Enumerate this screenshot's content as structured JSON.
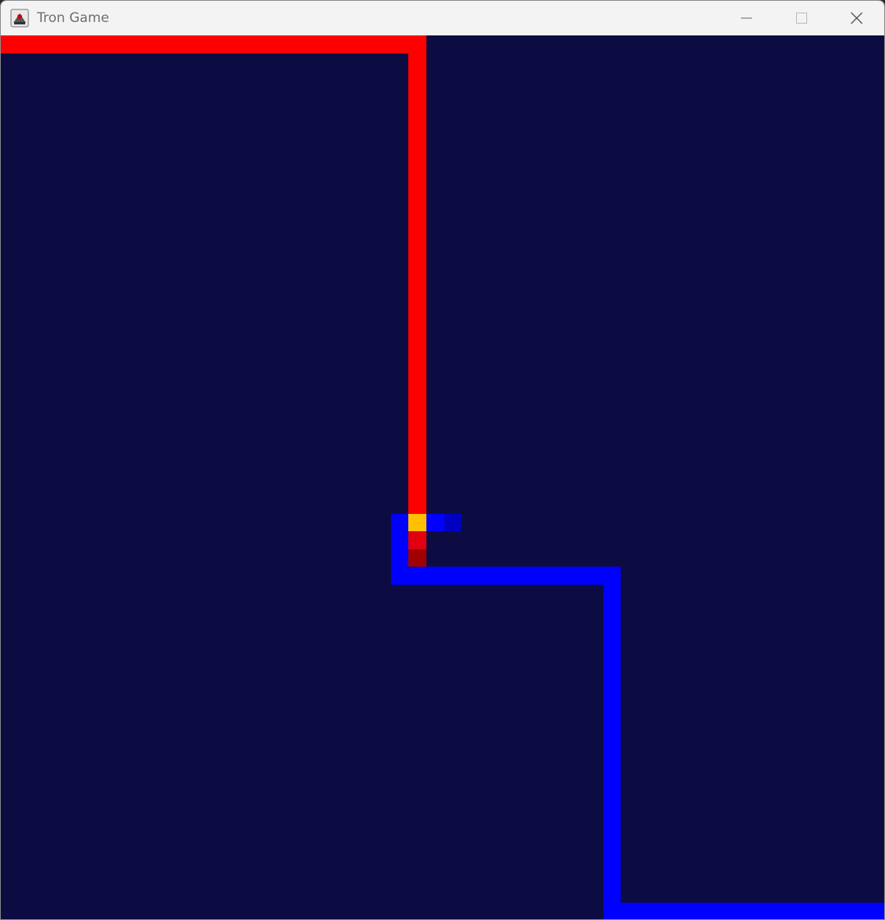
{
  "window": {
    "title": "Tron Game",
    "icon": "java-app-icon",
    "controls": [
      "minimize-icon",
      "maximize-icon",
      "close-icon"
    ]
  },
  "colors": {
    "background": "#0c0c42",
    "titlebar": "#f3f3f3",
    "red_trail": "#ff0000",
    "blue_trail": "#0000ff",
    "collision": "#ffc000",
    "red_dim": "#e00010",
    "red_dark": "#a00000",
    "blue_dark": "#0000c0"
  }
}
